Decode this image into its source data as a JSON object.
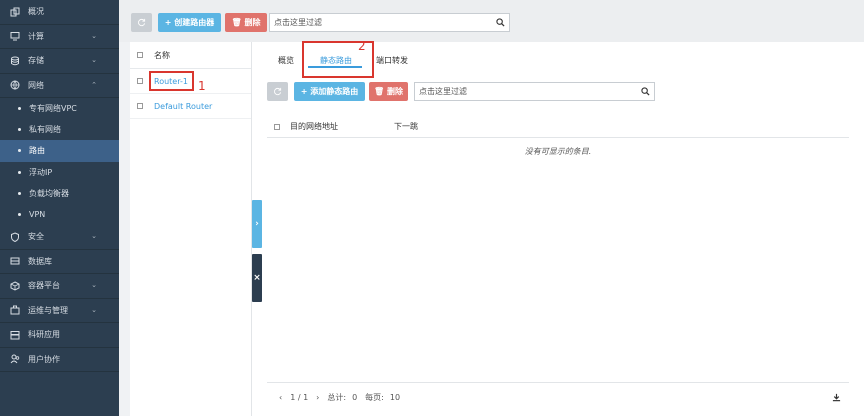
{
  "sidebar": {
    "items": [
      {
        "label": "概况",
        "icon": "copy-icon"
      },
      {
        "label": "计算",
        "icon": "monitor-icon",
        "chevron": "⌄"
      },
      {
        "label": "存储",
        "icon": "database-icon",
        "chevron": "⌄"
      },
      {
        "label": "网络",
        "icon": "globe-icon",
        "chevron": "⌃"
      }
    ],
    "network_sub": [
      {
        "label": "专有网络VPC"
      },
      {
        "label": "私有网络"
      },
      {
        "label": "路由"
      },
      {
        "label": "浮动IP"
      },
      {
        "label": "负载均衡器"
      },
      {
        "label": "VPN"
      }
    ],
    "items_after": [
      {
        "label": "安全",
        "icon": "shield-icon",
        "chevron": "⌄"
      },
      {
        "label": "数据库",
        "icon": "server-icon"
      },
      {
        "label": "容器平台",
        "icon": "container-icon",
        "chevron": "⌄"
      },
      {
        "label": "运维与管理",
        "icon": "toolbox-icon",
        "chevron": "⌄"
      },
      {
        "label": "科研应用",
        "icon": "archive-icon"
      },
      {
        "label": "用户协作",
        "icon": "users-icon"
      }
    ]
  },
  "toolbar": {
    "create_label": "+ 创建路由器",
    "delete_label": "🗑 删除",
    "search_placeholder": "点击这里过滤"
  },
  "router_list": {
    "header": "名称",
    "rows": [
      "Router-1",
      "Default Router"
    ]
  },
  "annotations": {
    "one": "1",
    "two": "2"
  },
  "tabs": [
    {
      "label": "概览"
    },
    {
      "label": "静态路由"
    },
    {
      "label": "端口转发"
    }
  ],
  "detail_toolbar": {
    "add_label": "+ 添加静态路由",
    "delete_label": "🗑 删除",
    "search_placeholder": "点击这里过滤"
  },
  "routes_table": {
    "columns": [
      "目的网络地址",
      "下一跳"
    ],
    "empty_text": "没有可显示的条目."
  },
  "pagination": {
    "prev": "‹",
    "page": "1 / 1",
    "next": "›",
    "total_label": "总计:",
    "total": "0",
    "per_page_label": "每页:",
    "per_page": "10"
  },
  "toggles": {
    "expand": "›",
    "close": "×"
  },
  "colors": {
    "sidebar": "#2c3e50",
    "accent": "#3a9bdc",
    "danger": "#e0736c",
    "highlight": "#d9362e"
  }
}
